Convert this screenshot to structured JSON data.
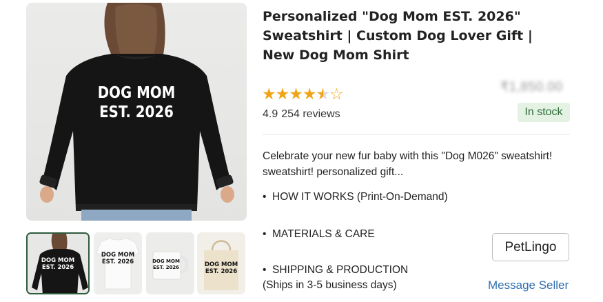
{
  "product": {
    "title_lines": [
      "Personalized \"Dog Mom EST. 2026\"",
      "Sweatshirt | Custom Dog Lover Gift |",
      "New Dog Mom Shirt"
    ],
    "print_text": [
      "DOG MOM",
      "EST. 2026"
    ],
    "thumb_prints": [
      [
        "DOG MOM",
        "EST. 2026"
      ],
      [
        "DOG MOM",
        "EST. 2026"
      ],
      [
        "DOG MOM",
        "EST. 2026"
      ],
      [
        "DOG MOM",
        "EST. 2026"
      ]
    ],
    "rating": {
      "value": 4.5,
      "stars_max": 5,
      "score_text": "4.9",
      "reviews_text": "254 reviews"
    },
    "price": "₹1,850.00",
    "stock": "In stock",
    "description_lines": [
      "Celebrate your new fur baby with this \"Dog M026\" sweatshirt!",
      "sweatshirt! personalized gift..."
    ],
    "bullets": [
      "HOW IT WORKS (Print-On-Demand)",
      "MATERIALS & CARE",
      "SHIPPING & PRODUCTION"
    ],
    "bullet_marker": "•",
    "shipping_note": "(Ships in 3-5 business days)",
    "seller_name": "PetLingo",
    "message_seller": "Message Seller"
  },
  "colors": {
    "accent_star": "#f0a415",
    "stock_bg": "#e3f2e3",
    "stock_text": "#2e6b36",
    "link": "#2f6fb0",
    "selected_thumb_border": "#2e5a3d"
  }
}
